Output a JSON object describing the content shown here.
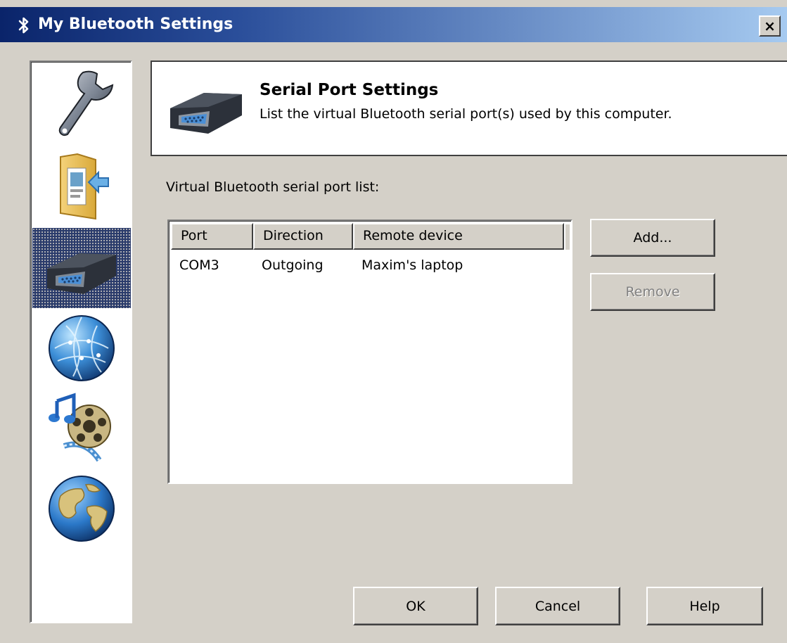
{
  "window": {
    "title": "My Bluetooth Settings",
    "close_label": "×"
  },
  "sidebar": {
    "items": [
      {
        "name": "general",
        "icon": "wrench-icon",
        "selected": false
      },
      {
        "name": "file-transfer",
        "icon": "folder-icon",
        "selected": false
      },
      {
        "name": "serial-port",
        "icon": "serial-port-icon",
        "selected": true
      },
      {
        "name": "network",
        "icon": "network-globe-icon",
        "selected": false
      },
      {
        "name": "multimedia",
        "icon": "multimedia-icon",
        "selected": false
      },
      {
        "name": "internet",
        "icon": "earth-globe-icon",
        "selected": false
      }
    ]
  },
  "header": {
    "icon": "serial-port-icon",
    "title": "Serial Port Settings",
    "description": "List the virtual Bluetooth serial port(s) used by this computer."
  },
  "port_list": {
    "caption": "Virtual Bluetooth serial port list:",
    "columns": [
      "Port",
      "Direction",
      "Remote device"
    ],
    "rows": [
      {
        "port": "COM3",
        "direction": "Outgoing",
        "remote_device": "Maxim's laptop"
      }
    ]
  },
  "side_buttons": {
    "add": "Add...",
    "remove": "Remove"
  },
  "footer_buttons": {
    "ok": "OK",
    "cancel": "Cancel",
    "help": "Help"
  },
  "colors": {
    "title_gradient_start": "#0a246a",
    "title_gradient_end": "#a6caf0",
    "dialog_bg": "#d4d0c8",
    "selection": "#2a3b6b"
  }
}
